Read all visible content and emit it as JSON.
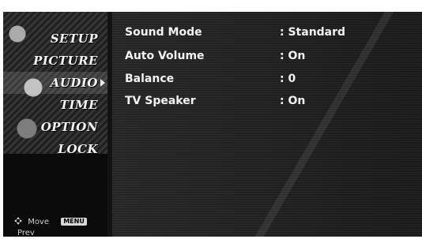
{
  "menu": {
    "items": [
      {
        "label": "SETUP"
      },
      {
        "label": "PICTURE"
      },
      {
        "label": "AUDIO",
        "selected": true
      },
      {
        "label": "TIME"
      },
      {
        "label": "OPTION"
      },
      {
        "label": "LOCK"
      }
    ],
    "hint": {
      "move_label": "Move",
      "menu_key_label": "MENU",
      "prev_label": "Prev"
    }
  },
  "audio_settings": [
    {
      "label": "Sound Mode",
      "value": ": Standard"
    },
    {
      "label": "Auto Volume",
      "value": ": On"
    },
    {
      "label": "Balance",
      "value": ": 0"
    },
    {
      "label": "TV Speaker",
      "value": ": On"
    }
  ],
  "colors": {
    "text": "#f2f2f2",
    "background_dark": "#141414"
  }
}
